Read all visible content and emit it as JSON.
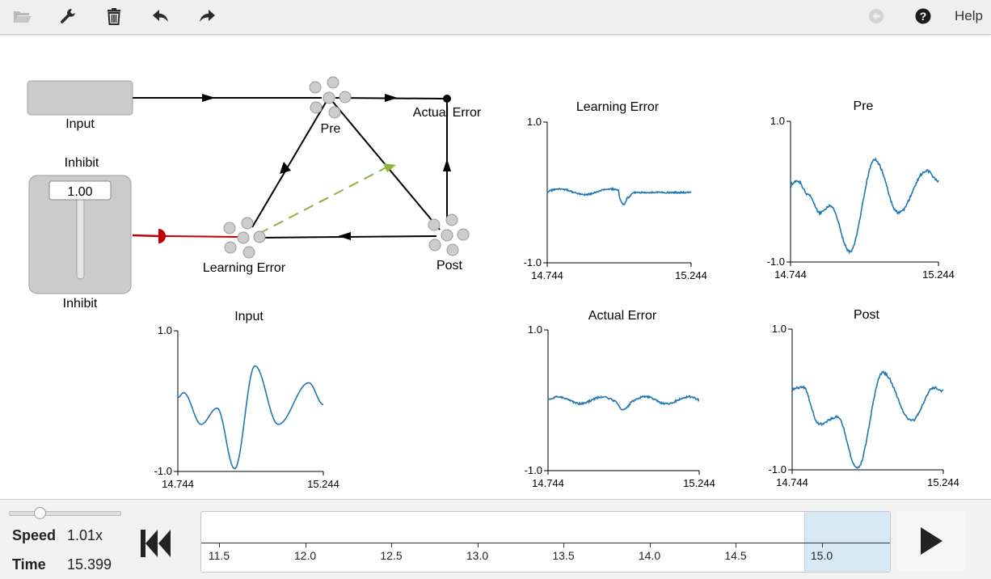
{
  "toolbar": {
    "help_label": "Help"
  },
  "network": {
    "input_label": "Input",
    "inhibit_title": "Inhibit",
    "inhibit_label": "Inhibit",
    "inhibit_value": "1.00",
    "pre_label": "Pre",
    "post_label": "Post",
    "learning_error_label": "Learning Error",
    "actual_error_label": "Actual Error"
  },
  "plots": {
    "input": {
      "title": "Input",
      "ymax": "1.0",
      "ymin": "-1.0",
      "xmin": "14.744",
      "xmax": "15.244"
    },
    "learning_error": {
      "title": "Learning Error",
      "ymax": "1.0",
      "ymin": "-1.0",
      "xmin": "14.744",
      "xmax": "15.244"
    },
    "pre": {
      "title": "Pre",
      "ymax": "1.0",
      "ymin": "-1.0",
      "xmin": "14.744",
      "xmax": "15.244"
    },
    "actual_error": {
      "title": "Actual Error",
      "ymax": "1.0",
      "ymin": "-1.0",
      "xmin": "14.744",
      "xmax": "15.244"
    },
    "post": {
      "title": "Post",
      "ymax": "1.0",
      "ymin": "-1.0",
      "xmin": "14.744",
      "xmax": "15.244"
    }
  },
  "controls": {
    "speed_label": "Speed",
    "speed_value": "1.01x",
    "time_label": "Time",
    "time_value": "15.399",
    "speed_slider_fraction": 0.27,
    "timeline_ticks": [
      "11.5",
      "12.0",
      "12.5",
      "13.0",
      "13.5",
      "14.0",
      "14.5",
      "15.0"
    ],
    "timeline_start": 11.5,
    "timeline_window": [
      14.9,
      15.4
    ]
  },
  "colors": {
    "trace": "#1f77b4",
    "inhibit_line": "#c00000",
    "learning_line": "#8cb43c",
    "highlight": "#d6e9f5"
  },
  "icons": [
    "folder-open-icon",
    "wrench-icon",
    "trash-icon",
    "undo-icon",
    "redo-icon",
    "back-circle-icon",
    "help-circle-icon",
    "skip-to-start-icon",
    "play-icon"
  ]
}
